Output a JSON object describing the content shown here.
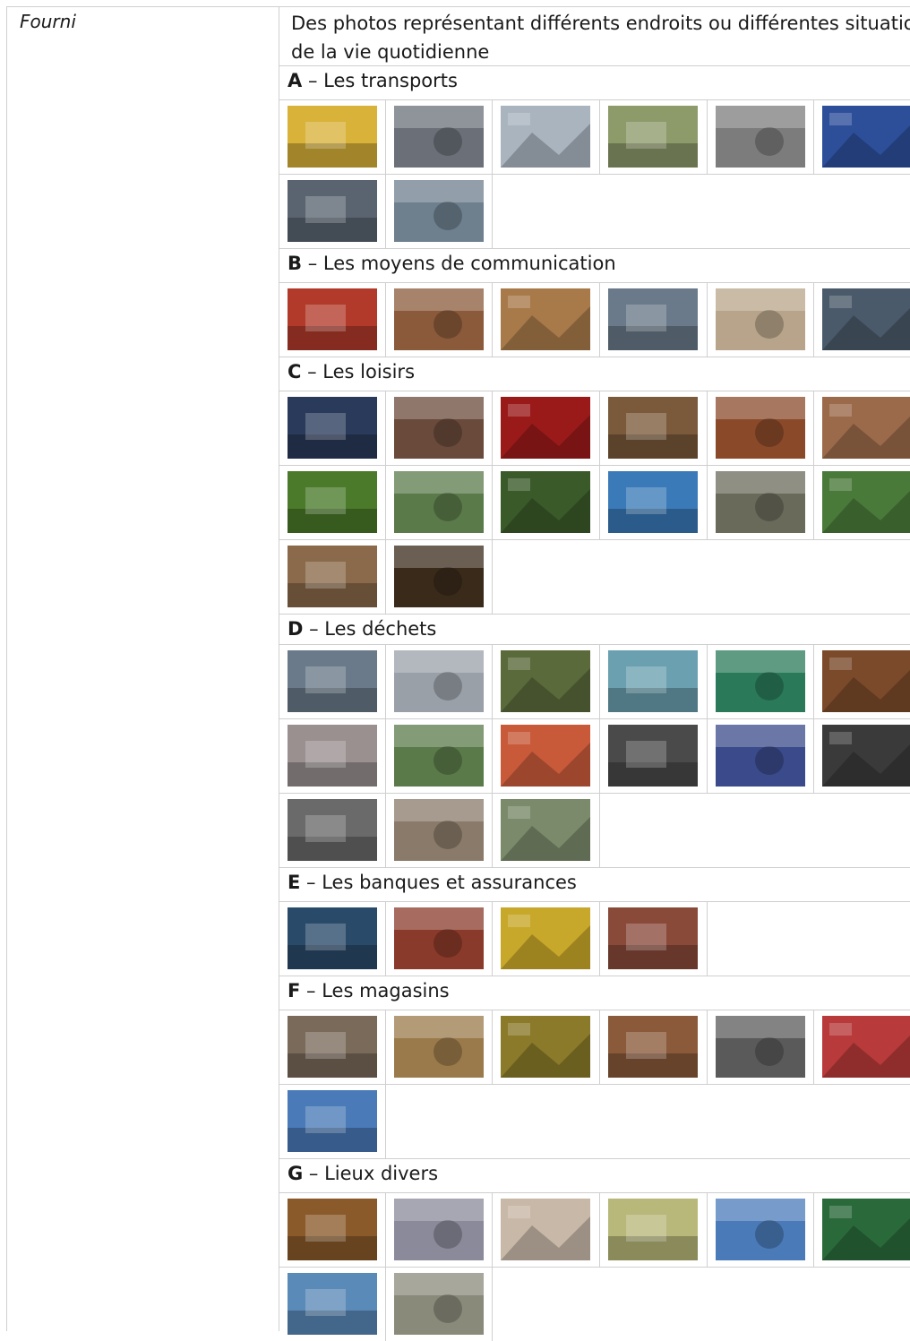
{
  "label": "Fourni",
  "description_line1": "Des photos représentant différents endroits ou différentes situations",
  "description_line2": "de la vie quotidienne",
  "sections": [
    {
      "letter": "A",
      "title": " – Les transports"
    },
    {
      "letter": "B",
      "title": " – Les moyens de communication"
    },
    {
      "letter": "C",
      "title": " – Les loisirs"
    },
    {
      "letter": "D",
      "title": " – Les déchets"
    },
    {
      "letter": "E",
      "title": " – Les banques et assurances"
    },
    {
      "letter": "F",
      "title": " – Les magasins"
    },
    {
      "letter": "G",
      "title": " – Lieux divers"
    }
  ],
  "photos": {
    "A": [
      "bus-photo",
      "metro-platform-photo",
      "train-station-photo",
      "shared-bikes-photo",
      "pedestrian-crossing-photo",
      "taxi-sign-photo",
      "car-photo",
      "motorbike-photo"
    ],
    "B": [
      "mailbox-photo",
      "internet-cafe-photo",
      "laptop-user-photo",
      "phone-shop-photo",
      "landline-phone-photo",
      "street-conversation-photo"
    ],
    "C": [
      "television-photo",
      "cinema-facade-photo",
      "theatre-stage-photo",
      "library-shelves-photo",
      "bookshop-photo",
      "family-gathering-photo",
      "park-alley-photo",
      "park-picnic-photo",
      "forest-photo",
      "beach-photo",
      "people-sitting-photo",
      "football-game-photo",
      "cafe-interior-photo",
      "birthday-cake-photo"
    ],
    "D": [
      "scrap-metal-photo",
      "trash-bags-photo",
      "dumped-waste-photo",
      "recycling-containers-photo",
      "green-bags-photo",
      "organic-waste-photo",
      "garbage-truck-photo",
      "bag-collection-photo",
      "chemical-bottles-photo",
      "battery-bin-photo",
      "batteries-photo",
      "light-bulb-photo",
      "old-appliances-photo",
      "bulky-waste-photo",
      "bottle-bank-photo"
    ],
    "E": [
      "atm-photo",
      "bank-office-photo",
      "western-union-sign-photo",
      "bank-facade-photo"
    ],
    "F": [
      "market-stall-photo",
      "grocery-store-photo",
      "night-shop-photo",
      "fruit-market-photo",
      "clothing-mannequins-photo",
      "appliance-store-photo",
      "supermarket-parking-photo"
    ],
    "G": [
      "classroom-photo",
      "hospital-room-photo",
      "doctor-visit-photo",
      "notice-board-photo",
      "cpas-building-photo",
      "shopfront-photo",
      "town-hall-photo",
      "elderly-table-photo"
    ]
  },
  "palette": {
    "A": [
      "#d9b23a",
      "#6a6f78",
      "#a9b4bf",
      "#8d9a6a",
      "#7c7c7c",
      "#2d4f9a",
      "#5a6470",
      "#6e7f8e"
    ],
    "B": [
      "#b23a2a",
      "#8a5a3a",
      "#a87a4a",
      "#6a7a8a",
      "#b8a48a",
      "#4a5a6a"
    ],
    "C": [
      "#2a3a5a",
      "#6a4a3a",
      "#9a1a1a",
      "#7a5a3a",
      "#8a4a2a",
      "#9a6a4a",
      "#4a7a2a",
      "#5a7a4a",
      "#3a5a2a",
      "#3a7ab8",
      "#6a6a5a",
      "#4a7a3a",
      "#8a6a4a",
      "#3a2a1a"
    ],
    "D": [
      "#6a7a8a",
      "#9aa0a8",
      "#5a6a3a",
      "#6aa0b0",
      "#2a7a5a",
      "#7a4a2a",
      "#9a9090",
      "#5a7a4a",
      "#c85a3a",
      "#4a4a4a",
      "#3a4a8a",
      "#3a3a3a",
      "#6a6a6a",
      "#8a7a6a",
      "#7a8a6a"
    ],
    "E": [
      "#2a4a6a",
      "#8a3a2a",
      "#c8a82a",
      "#8a4a3a"
    ],
    "F": [
      "#7a6a5a",
      "#9a7a4a",
      "#8a7a2a",
      "#8a5a3a",
      "#5a5a5a",
      "#b83a3a",
      "#4a7ab8"
    ],
    "G": [
      "#8a5a2a",
      "#8a8a9a",
      "#c8b8a8",
      "#b8b87a",
      "#4a7ab8",
      "#2a6a3a",
      "#5a8ab8",
      "#8a8a7a"
    ]
  }
}
